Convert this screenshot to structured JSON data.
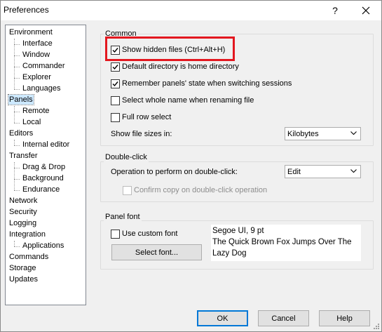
{
  "window": {
    "title": "Preferences",
    "help_label": "?"
  },
  "tree": {
    "items": [
      {
        "label": "Environment",
        "level": 0
      },
      {
        "label": "Interface",
        "level": 1
      },
      {
        "label": "Window",
        "level": 1
      },
      {
        "label": "Commander",
        "level": 1
      },
      {
        "label": "Explorer",
        "level": 1
      },
      {
        "label": "Languages",
        "level": 1
      },
      {
        "label": "Panels",
        "level": 0,
        "selected": true
      },
      {
        "label": "Remote",
        "level": 1
      },
      {
        "label": "Local",
        "level": 1
      },
      {
        "label": "Editors",
        "level": 0
      },
      {
        "label": "Internal editor",
        "level": 1
      },
      {
        "label": "Transfer",
        "level": 0
      },
      {
        "label": "Drag & Drop",
        "level": 1
      },
      {
        "label": "Background",
        "level": 1
      },
      {
        "label": "Endurance",
        "level": 1
      },
      {
        "label": "Network",
        "level": 0
      },
      {
        "label": "Security",
        "level": 0
      },
      {
        "label": "Logging",
        "level": 0
      },
      {
        "label": "Integration",
        "level": 0
      },
      {
        "label": "Applications",
        "level": 1
      },
      {
        "label": "Commands",
        "level": 0
      },
      {
        "label": "Storage",
        "level": 0
      },
      {
        "label": "Updates",
        "level": 0
      }
    ]
  },
  "common": {
    "title": "Common",
    "show_hidden": {
      "label": "Show hidden files (Ctrl+Alt+H)",
      "checked": true
    },
    "default_dir_home": {
      "label": "Default directory is home directory",
      "checked": true
    },
    "remember_state": {
      "label": "Remember panels' state when switching sessions",
      "checked": true
    },
    "select_whole_name": {
      "label": "Select whole name when renaming file",
      "checked": false
    },
    "full_row_select": {
      "label": "Full row select",
      "checked": false
    },
    "file_sizes_label": "Show file sizes in:",
    "file_sizes_value": "Kilobytes"
  },
  "double_click": {
    "title": "Double-click",
    "operation_label": "Operation to perform on double-click:",
    "operation_value": "Edit",
    "confirm_copy": {
      "label": "Confirm copy on double-click operation",
      "checked": false,
      "enabled": false
    }
  },
  "panel_font": {
    "title": "Panel font",
    "use_custom": {
      "label": "Use custom font",
      "checked": false
    },
    "select_font_label": "Select font...",
    "preview_line1": "Segoe UI, 9 pt",
    "preview_line2": "The Quick Brown Fox Jumps Over The Lazy Dog"
  },
  "buttons": {
    "ok": "OK",
    "cancel": "Cancel",
    "help": "Help"
  },
  "colors": {
    "highlight": "#e3171f",
    "selection": "#cce8ff",
    "default_button_border": "#0078d7"
  }
}
